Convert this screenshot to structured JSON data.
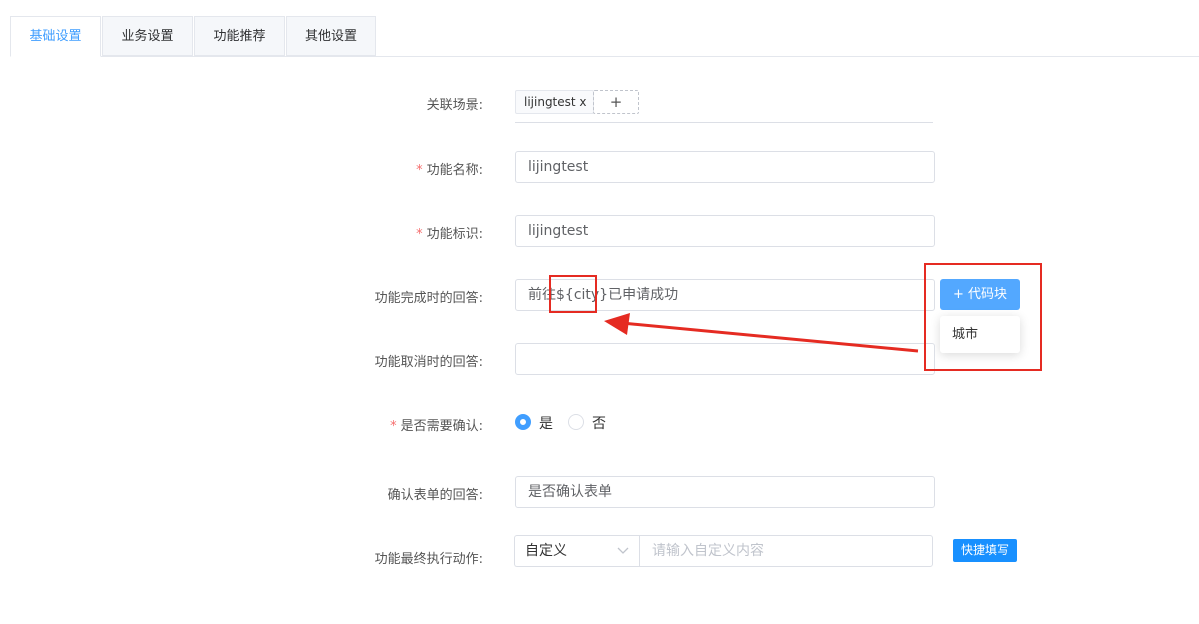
{
  "tabs": [
    {
      "label": "基础设置"
    },
    {
      "label": "业务设置"
    },
    {
      "label": "功能推荐"
    },
    {
      "label": "其他设置"
    }
  ],
  "form": {
    "scene": {
      "label": "关联场景:",
      "tag": "lijingtest x",
      "add": "+"
    },
    "name": {
      "label": "功能名称:",
      "value": "lijingtest"
    },
    "identifier": {
      "label": "功能标识:",
      "value": "lijingtest"
    },
    "complete_answer": {
      "label": "功能完成时的回答:",
      "value_prefix": "前往",
      "value_var": "${city}",
      "value_suffix": "已申请成功"
    },
    "cancel_answer": {
      "label": "功能取消时的回答:",
      "value": ""
    },
    "confirm": {
      "label": "是否需要确认:",
      "yes": "是",
      "no": "否",
      "selected": "是"
    },
    "confirm_answer": {
      "label": "确认表单的回答:",
      "value": "是否确认表单"
    },
    "final_action": {
      "label": "功能最终执行动作:",
      "select": "自定义",
      "placeholder": "请输入自定义内容",
      "quick_fill": "快捷填写"
    }
  },
  "code_block": {
    "button": "+ 代码块",
    "options": [
      "城市"
    ]
  },
  "icons": {
    "chevron": "chevron-down-icon"
  },
  "colors": {
    "accent": "#409eff",
    "required": "#f56c6c",
    "annotation": "#e52b22"
  }
}
